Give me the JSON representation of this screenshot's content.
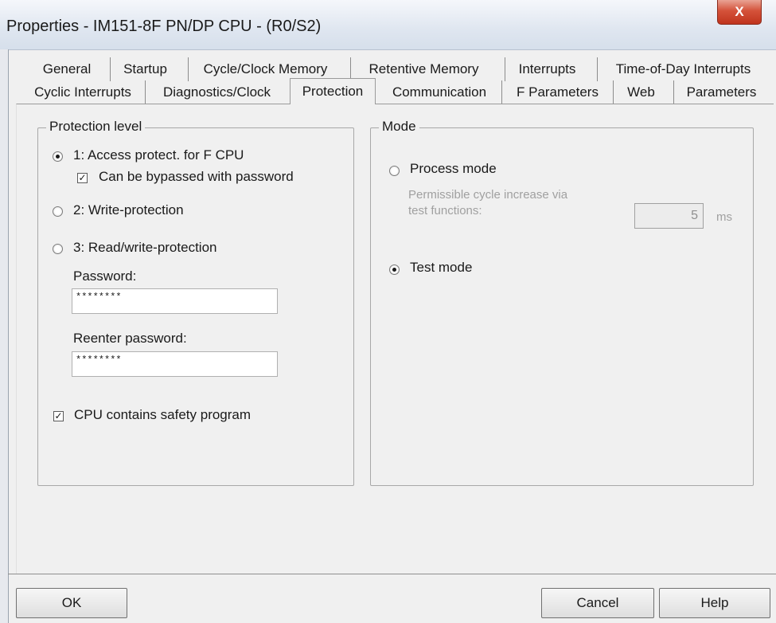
{
  "window": {
    "title": "Properties - IM151-8F PN/DP CPU - (R0/S2)",
    "close_label": "X"
  },
  "tabs": {
    "row1": [
      "General",
      "Startup",
      "Cycle/Clock Memory",
      "Retentive Memory",
      "Interrupts",
      "Time-of-Day Interrupts"
    ],
    "row2": [
      "Cyclic Interrupts",
      "Diagnostics/Clock",
      "Protection",
      "Communication",
      "F Parameters",
      "Web",
      "Parameters"
    ],
    "active": "Protection"
  },
  "protection_level": {
    "title": "Protection level",
    "option1": "1: Access protect. for F CPU",
    "option1_selected": true,
    "bypass_label": "Can be bypassed with password",
    "bypass_checked": true,
    "option2": "2: Write-protection",
    "option3": "3: Read/write-protection",
    "password_label": "Password:",
    "password_value": "********",
    "reenter_label": "Reenter password:",
    "reenter_value": "********",
    "safety_label": "CPU contains safety program",
    "safety_checked": true
  },
  "mode": {
    "title": "Mode",
    "process_label": "Process mode",
    "permissible_line1": "Permissible  cycle increase via",
    "permissible_line2": "test functions:",
    "cycle_value": "5",
    "unit": "ms",
    "test_label": "Test mode",
    "selected": "Test mode"
  },
  "buttons": {
    "ok": "OK",
    "cancel": "Cancel",
    "help": "Help"
  },
  "glyphs": {
    "check": "✓"
  }
}
